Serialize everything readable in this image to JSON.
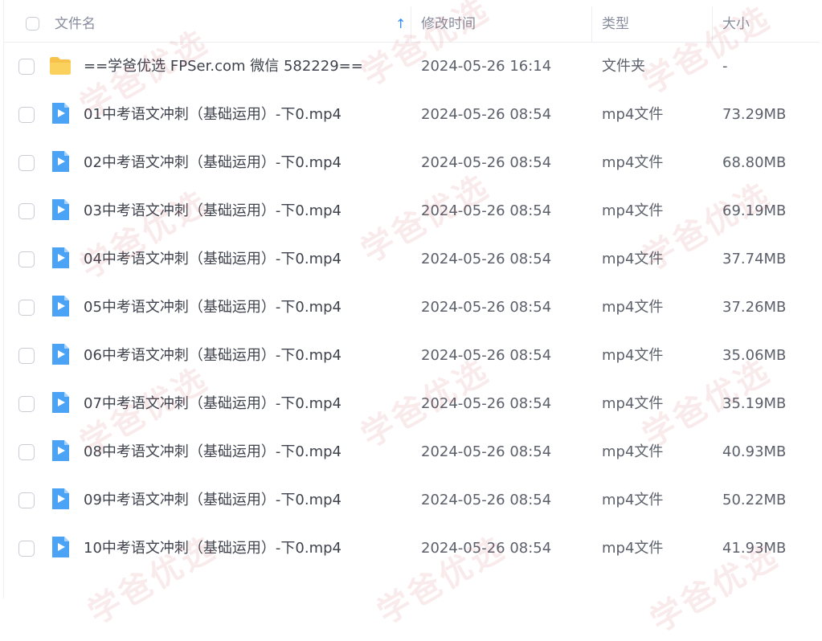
{
  "header": {
    "name_label": "文件名",
    "sort_indicator": "↑",
    "modified_label": "修改时间",
    "type_label": "类型",
    "size_label": "大小"
  },
  "rows": [
    {
      "name": "==学爸优选 FPSer.com 微信 582229==",
      "modified": "2024-05-26 16:14",
      "type": "文件夹",
      "size": "-",
      "icon": "folder-icon"
    },
    {
      "name": "01中考语文冲刺（基础运用）-下0.mp4",
      "modified": "2024-05-26 08:54",
      "type": "mp4文件",
      "size": "73.29MB",
      "icon": "video-file-icon"
    },
    {
      "name": "02中考语文冲刺（基础运用）-下0.mp4",
      "modified": "2024-05-26 08:54",
      "type": "mp4文件",
      "size": "68.80MB",
      "icon": "video-file-icon"
    },
    {
      "name": "03中考语文冲刺（基础运用）-下0.mp4",
      "modified": "2024-05-26 08:54",
      "type": "mp4文件",
      "size": "69.19MB",
      "icon": "video-file-icon"
    },
    {
      "name": "04中考语文冲刺（基础运用）-下0.mp4",
      "modified": "2024-05-26 08:54",
      "type": "mp4文件",
      "size": "37.74MB",
      "icon": "video-file-icon"
    },
    {
      "name": "05中考语文冲刺（基础运用）-下0.mp4",
      "modified": "2024-05-26 08:54",
      "type": "mp4文件",
      "size": "37.26MB",
      "icon": "video-file-icon"
    },
    {
      "name": "06中考语文冲刺（基础运用）-下0.mp4",
      "modified": "2024-05-26 08:54",
      "type": "mp4文件",
      "size": "35.06MB",
      "icon": "video-file-icon"
    },
    {
      "name": "07中考语文冲刺（基础运用）-下0.mp4",
      "modified": "2024-05-26 08:54",
      "type": "mp4文件",
      "size": "35.19MB",
      "icon": "video-file-icon"
    },
    {
      "name": "08中考语文冲刺（基础运用）-下0.mp4",
      "modified": "2024-05-26 08:54",
      "type": "mp4文件",
      "size": "40.93MB",
      "icon": "video-file-icon"
    },
    {
      "name": "09中考语文冲刺（基础运用）-下0.mp4",
      "modified": "2024-05-26 08:54",
      "type": "mp4文件",
      "size": "50.22MB",
      "icon": "video-file-icon"
    },
    {
      "name": "10中考语文冲刺（基础运用）-下0.mp4",
      "modified": "2024-05-26 08:54",
      "type": "mp4文件",
      "size": "41.93MB",
      "icon": "video-file-icon"
    }
  ],
  "watermark": {
    "text": "学爸优选"
  },
  "colors": {
    "accent": "#2f8cf7",
    "folder": "#f7c24a",
    "video_icon": "#4aa3f5"
  }
}
